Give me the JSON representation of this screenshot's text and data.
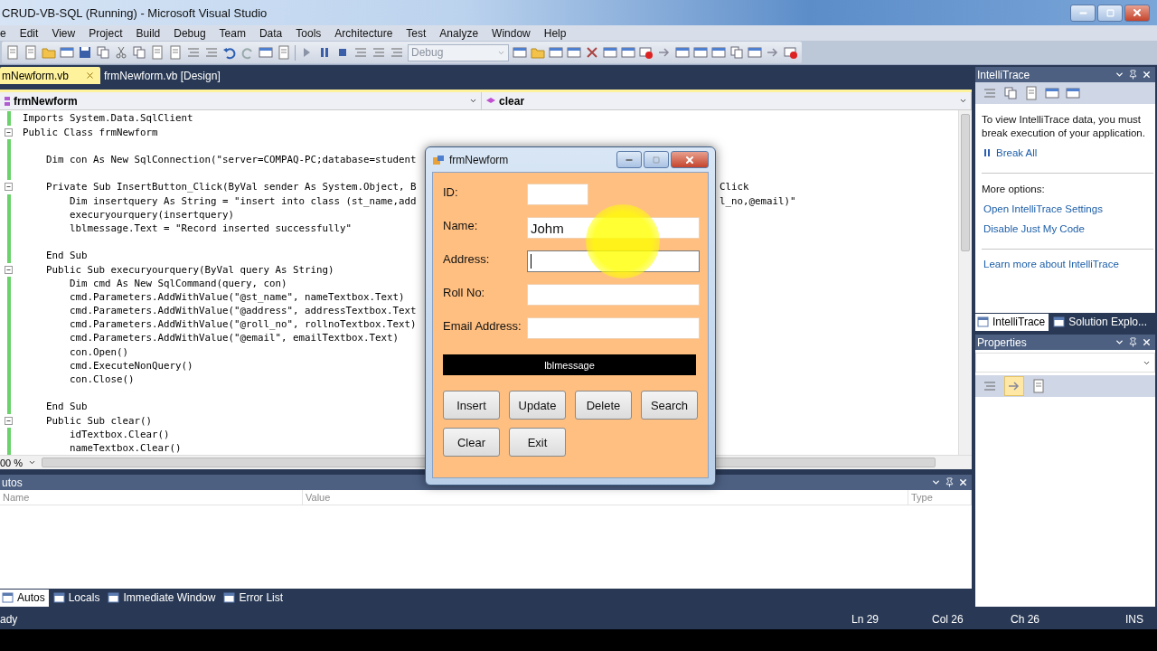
{
  "window": {
    "title": "CRUD-VB-SQL (Running) - Microsoft Visual Studio"
  },
  "menu": [
    "e",
    "Edit",
    "View",
    "Project",
    "Build",
    "Debug",
    "Team",
    "Data",
    "Tools",
    "Architecture",
    "Test",
    "Analyze",
    "Window",
    "Help"
  ],
  "toolbar": {
    "configuration": "Debug"
  },
  "editor": {
    "tabs": [
      {
        "label": "mNewform.vb",
        "selected": true
      },
      {
        "label": "frmNewform.vb [Design]",
        "selected": false
      }
    ],
    "type_dropdown": "frmNewform",
    "member_dropdown": "clear",
    "lines": [
      {
        "kind": "code",
        "text": "Imports System.Data.SqlClient"
      },
      {
        "kind": "code",
        "text": "Public Class frmNewform",
        "fold": true
      },
      {
        "kind": "blank"
      },
      {
        "kind": "code",
        "text": "    Dim con As New SqlConnection(\"server=COMPAQ-PC;database=student"
      },
      {
        "kind": "blank"
      },
      {
        "kind": "code",
        "text": "    Private Sub InsertButton_Click(ByVal sender As System.Object, B",
        "tail": "Click",
        "fold": true
      },
      {
        "kind": "code",
        "text": "        Dim insertquery As String = \"insert into class (st_name,add",
        "tail": "l_no,@email)\""
      },
      {
        "kind": "code",
        "text": "        execuryourquery(insertquery)"
      },
      {
        "kind": "code",
        "text": "        lblmessage.Text = \"Record inserted successfully\""
      },
      {
        "kind": "blank"
      },
      {
        "kind": "code",
        "text": "    End Sub"
      },
      {
        "kind": "code",
        "text": "    Public Sub execuryourquery(ByVal query As String)",
        "fold": true
      },
      {
        "kind": "code",
        "text": "        Dim cmd As New SqlCommand(query, con)"
      },
      {
        "kind": "code",
        "text": "        cmd.Parameters.AddWithValue(\"@st_name\", nameTextbox.Text)"
      },
      {
        "kind": "code",
        "text": "        cmd.Parameters.AddWithValue(\"@address\", addressTextbox.Text"
      },
      {
        "kind": "code",
        "text": "        cmd.Parameters.AddWithValue(\"@roll_no\", rollnoTextbox.Text)"
      },
      {
        "kind": "code",
        "text": "        cmd.Parameters.AddWithValue(\"@email\", emailTextbox.Text)"
      },
      {
        "kind": "code",
        "text": "        con.Open()"
      },
      {
        "kind": "code",
        "text": "        cmd.ExecuteNonQuery()"
      },
      {
        "kind": "code",
        "text": "        con.Close()"
      },
      {
        "kind": "blank"
      },
      {
        "kind": "code",
        "text": "    End Sub"
      },
      {
        "kind": "code",
        "text": "    Public Sub clear()",
        "fold": true
      },
      {
        "kind": "code",
        "text": "        idTextbox.Clear()"
      },
      {
        "kind": "code",
        "text": "        nameTextbox.Clear()"
      }
    ],
    "zoom": "00 %"
  },
  "autos": {
    "title": "utos",
    "columns": [
      "Name",
      "Value",
      "Type"
    ],
    "tabs": [
      {
        "label": "Autos",
        "selected": true
      },
      {
        "label": "Locals",
        "selected": false
      },
      {
        "label": "Immediate Window",
        "selected": false
      },
      {
        "label": "Error List",
        "selected": false
      }
    ]
  },
  "intellitrace": {
    "title": "IntelliTrace",
    "message": "To view IntelliTrace data, you must break execution of your application.",
    "break_link": "Break All",
    "more_options": "More options:",
    "links": [
      "Open IntelliTrace Settings",
      "Disable Just My Code"
    ],
    "learn_link": "Learn more about IntelliTrace",
    "tabs": [
      {
        "label": "IntelliTrace",
        "selected": true
      },
      {
        "label": "Solution Explo...",
        "selected": false
      }
    ]
  },
  "properties": {
    "title": "Properties"
  },
  "status_bar": {
    "message": "ady",
    "line": "Ln 29",
    "column": "Col 26",
    "char": "Ch 26",
    "mode": "INS"
  },
  "form": {
    "title": "frmNewform",
    "fields": [
      {
        "label": "ID:",
        "short": true,
        "focused": false
      },
      {
        "label": "Name:",
        "value": "Johm",
        "focused": false
      },
      {
        "label": "Address:",
        "focused": true
      },
      {
        "label": "Roll No:",
        "focused": false
      },
      {
        "label": "Email Address:",
        "focused": false
      }
    ],
    "message": "lblmessage",
    "buttons": [
      "Insert",
      "Update",
      "Delete",
      "Search",
      "Clear",
      "Exit"
    ]
  }
}
